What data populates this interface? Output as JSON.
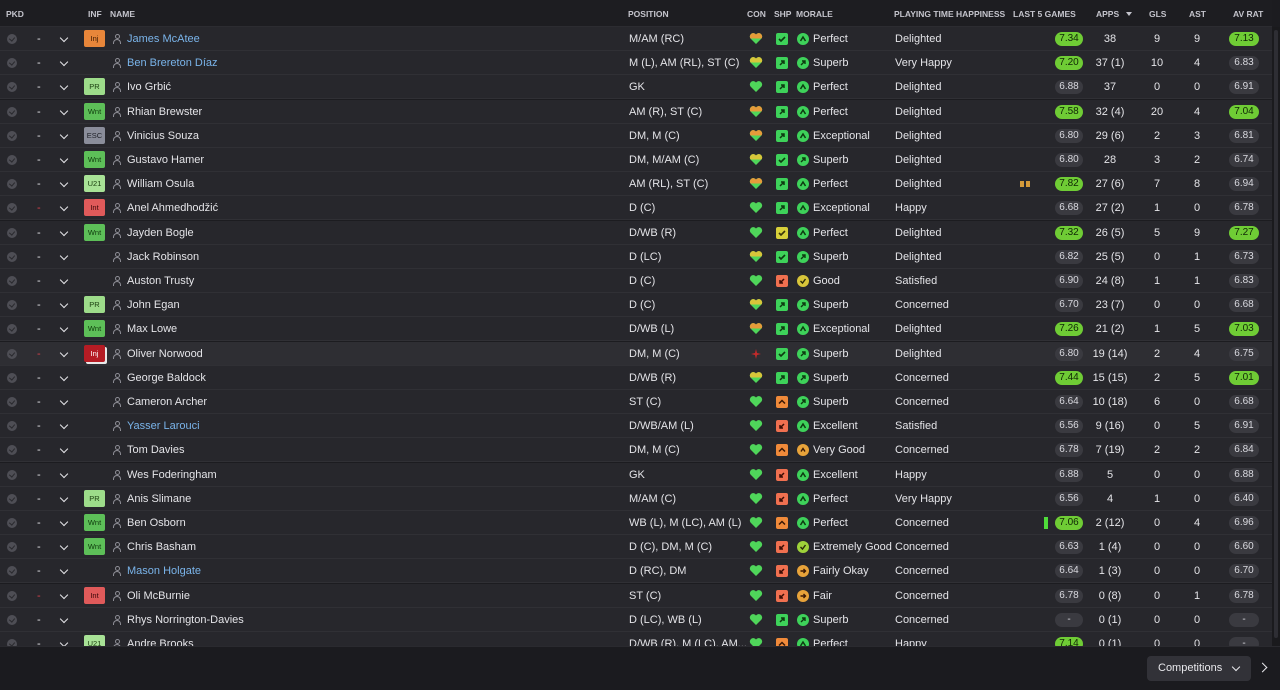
{
  "columns": {
    "pkd": "PKD",
    "inf": "INF",
    "name": "NAME",
    "position": "POSITION",
    "con": "CON",
    "shp": "SHP",
    "morale": "MORALE",
    "pth": "PLAYING TIME HAPPINESS",
    "last5": "LAST 5 GAMES",
    "apps": "APPS",
    "gls": "GLS",
    "ast": "AST",
    "avrat": "AV RAT"
  },
  "sort": {
    "column": "apps",
    "direction": "descending"
  },
  "colors": {
    "accent_green": "#6fcc35",
    "link_blue": "#7ab4ea",
    "injury_red": "#b51c24"
  },
  "players": [
    {
      "pkd": "-",
      "inf": "Inj",
      "name": "James McAtee",
      "link": true,
      "position": "M/AM (RC)",
      "con": "half",
      "shp": "check",
      "morale": "Perfect",
      "pth": "Delighted",
      "form": [
        "m",
        "m",
        "m",
        "m"
      ],
      "form_rating": "7.34",
      "form_green": true,
      "apps": "38",
      "gls": "9",
      "ast": "9",
      "avrat": "7.13",
      "avrat_green": true
    },
    {
      "pkd": "-",
      "inf": "",
      "name": "Ben Brereton Díaz",
      "link": true,
      "position": "M (L), AM (RL), ST (C)",
      "con": "half-y",
      "shp": "up-arrow",
      "morale": "Superb",
      "pth": "Very Happy",
      "form": [
        "h",
        "m",
        "m",
        "m"
      ],
      "form_rating": "7.20",
      "form_green": true,
      "apps": "37 (1)",
      "gls": "10",
      "ast": "4",
      "avrat": "6.83",
      "avrat_green": false
    },
    {
      "pkd": "-",
      "inf": "PR",
      "name": "Ivo Grbić",
      "link": false,
      "position": "GK",
      "con": "full",
      "shp": "up-arrow",
      "morale": "Perfect",
      "pth": "Delighted",
      "form": [
        "m",
        "m",
        "m",
        "m",
        "m"
      ],
      "form_rating": "6.88",
      "form_green": false,
      "apps": "37",
      "gls": "0",
      "ast": "0",
      "avrat": "6.91",
      "avrat_green": false
    },
    {
      "pkd": "-",
      "inf": "Wnt",
      "name": "Rhian Brewster",
      "link": false,
      "position": "AM (R), ST (C)",
      "con": "half",
      "shp": "up-arrow",
      "morale": "Perfect",
      "pth": "Delighted",
      "form": [
        "m",
        "m",
        "h",
        "m",
        "h"
      ],
      "form_rating": "7.58",
      "form_green": true,
      "apps": "32 (4)",
      "gls": "20",
      "ast": "4",
      "avrat": "7.04",
      "avrat_green": true
    },
    {
      "pkd": "-",
      "inf": "ESC",
      "name": "Vinicius Souza",
      "link": false,
      "position": "DM, M (C)",
      "con": "half",
      "shp": "up-arrow",
      "morale": "Exceptional",
      "pth": "Delighted",
      "form": [
        "m",
        "m",
        "m",
        "m",
        "m"
      ],
      "form_rating": "6.80",
      "form_green": false,
      "apps": "29 (6)",
      "gls": "2",
      "ast": "3",
      "avrat": "6.81",
      "avrat_green": false
    },
    {
      "pkd": "-",
      "inf": "Wnt",
      "name": "Gustavo Hamer",
      "link": false,
      "position": "DM, M/AM (C)",
      "con": "half-y",
      "shp": "check",
      "morale": "Superb",
      "pth": "Delighted",
      "form": [
        "m",
        "m",
        "m",
        "m",
        "m"
      ],
      "form_rating": "6.80",
      "form_green": false,
      "apps": "28",
      "gls": "3",
      "ast": "2",
      "avrat": "6.74",
      "avrat_green": false
    },
    {
      "pkd": "-",
      "inf": "U21",
      "name": "William Osula",
      "link": false,
      "position": "AM (RL), ST (C)",
      "con": "half",
      "shp": "up-arrow",
      "morale": "Perfect",
      "pth": "Delighted",
      "form": [
        "lo",
        "lo",
        "m",
        "h",
        "h"
      ],
      "form_rating": "7.82",
      "form_green": true,
      "apps": "27 (6)",
      "gls": "7",
      "ast": "8",
      "avrat": "6.94",
      "avrat_green": false
    },
    {
      "pkd": "-",
      "pkd_red": true,
      "inf": "Int",
      "name": "Anel Ahmedhodžić",
      "link": false,
      "position": "D (C)",
      "con": "full",
      "shp": "up-arrow",
      "morale": "Exceptional",
      "pth": "Happy",
      "form": [
        "m",
        "m",
        "m",
        "m",
        "m"
      ],
      "form_rating": "6.68",
      "form_green": false,
      "apps": "27 (2)",
      "gls": "1",
      "ast": "0",
      "avrat": "6.78",
      "avrat_green": false
    },
    {
      "pkd": "-",
      "inf": "Wnt",
      "name": "Jayden Bogle",
      "link": false,
      "position": "D/WB (R)",
      "con": "full",
      "shp": "check-y",
      "morale": "Perfect",
      "pth": "Delighted",
      "form": [
        "m",
        "m",
        "m",
        "m"
      ],
      "form_rating": "7.32",
      "form_green": true,
      "apps": "26 (5)",
      "gls": "5",
      "ast": "9",
      "avrat": "7.27",
      "avrat_green": true
    },
    {
      "pkd": "-",
      "inf": "",
      "name": "Jack Robinson",
      "link": false,
      "position": "D (LC)",
      "con": "half-y",
      "shp": "check",
      "morale": "Superb",
      "pth": "Delighted",
      "form": [
        "m",
        "m",
        "m",
        "m",
        "m"
      ],
      "form_rating": "6.82",
      "form_green": false,
      "apps": "25 (5)",
      "gls": "0",
      "ast": "1",
      "avrat": "6.73",
      "avrat_green": false
    },
    {
      "pkd": "-",
      "inf": "",
      "name": "Auston Trusty",
      "link": false,
      "position": "D (C)",
      "con": "full",
      "shp": "down-arrow",
      "morale": "Good",
      "pth": "Satisfied",
      "form": [
        "m",
        "m",
        "m",
        "m",
        "m"
      ],
      "form_rating": "6.90",
      "form_green": false,
      "apps": "24 (8)",
      "gls": "1",
      "ast": "1",
      "avrat": "6.83",
      "avrat_green": false
    },
    {
      "pkd": "-",
      "inf": "PR",
      "name": "John Egan",
      "link": false,
      "position": "D (C)",
      "con": "half-y",
      "shp": "up-arrow",
      "morale": "Superb",
      "pth": "Concerned",
      "form": [
        "m",
        "m",
        "m",
        "m",
        "m"
      ],
      "form_rating": "6.70",
      "form_green": false,
      "apps": "23 (7)",
      "gls": "0",
      "ast": "0",
      "avrat": "6.68",
      "avrat_green": false
    },
    {
      "pkd": "-",
      "inf": "Wnt",
      "name": "Max Lowe",
      "link": false,
      "position": "D/WB (L)",
      "con": "half",
      "shp": "up-arrow",
      "morale": "Exceptional",
      "pth": "Delighted",
      "form": [
        "m",
        "m",
        "m",
        "m"
      ],
      "form_rating": "7.26",
      "form_green": true,
      "apps": "21 (2)",
      "gls": "1",
      "ast": "5",
      "avrat": "7.03",
      "avrat_green": true
    },
    {
      "pkd": "-",
      "pkd_red": true,
      "inf": "InjRed",
      "inf_label": "Inj",
      "name": "Oliver Norwood",
      "link": false,
      "position": "DM, M (C)",
      "con": "injury",
      "shp": "check",
      "morale": "Superb",
      "pth": "Delighted",
      "form": [
        "m",
        "m",
        "m",
        "m",
        "m"
      ],
      "form_rating": "6.80",
      "form_green": false,
      "apps": "19 (14)",
      "gls": "2",
      "ast": "4",
      "avrat": "6.75",
      "avrat_green": false,
      "highlight": true
    },
    {
      "pkd": "-",
      "inf": "",
      "name": "George Baldock",
      "link": false,
      "position": "D/WB (R)",
      "con": "half-y",
      "shp": "up-arrow",
      "morale": "Superb",
      "pth": "Concerned",
      "form": [
        "h",
        "h",
        "h",
        "h"
      ],
      "form_rating": "7.44",
      "form_green": true,
      "apps": "15 (15)",
      "gls": "2",
      "ast": "5",
      "avrat": "7.01",
      "avrat_green": true
    },
    {
      "pkd": "-",
      "inf": "",
      "name": "Cameron Archer",
      "link": false,
      "position": "ST (C)",
      "con": "full",
      "shp": "up-o",
      "morale": "Superb",
      "pth": "Concerned",
      "form": [
        "m",
        "m",
        "m",
        "m",
        "m"
      ],
      "form_rating": "6.64",
      "form_green": false,
      "apps": "10 (18)",
      "gls": "6",
      "ast": "0",
      "avrat": "6.68",
      "avrat_green": false
    },
    {
      "pkd": "-",
      "inf": "",
      "name": "Yasser Larouci",
      "link": true,
      "position": "D/WB/AM (L)",
      "con": "full",
      "shp": "down-arrow",
      "morale": "Excellent",
      "pth": "Satisfied",
      "form": [
        "m",
        "m",
        "m",
        "m",
        "m"
      ],
      "form_rating": "6.56",
      "form_green": false,
      "apps": "9 (16)",
      "gls": "0",
      "ast": "5",
      "avrat": "6.91",
      "avrat_green": false
    },
    {
      "pkd": "-",
      "inf": "",
      "name": "Tom Davies",
      "link": false,
      "position": "DM, M (C)",
      "con": "full",
      "shp": "up-o",
      "morale": "Very Good",
      "pth": "Concerned",
      "form": [
        "m",
        "m",
        "m",
        "m",
        "m"
      ],
      "form_rating": "6.78",
      "form_green": false,
      "apps": "7 (19)",
      "gls": "2",
      "ast": "2",
      "avrat": "6.84",
      "avrat_green": false
    },
    {
      "pkd": "-",
      "inf": "",
      "name": "Wes Foderingham",
      "link": false,
      "position": "GK",
      "con": "full",
      "shp": "down-arrow",
      "morale": "Excellent",
      "pth": "Happy",
      "form": [
        "m",
        "m",
        "m",
        "m",
        "m"
      ],
      "form_rating": "6.88",
      "form_green": false,
      "apps": "5",
      "gls": "0",
      "ast": "0",
      "avrat": "6.88",
      "avrat_green": false
    },
    {
      "pkd": "-",
      "inf": "PR",
      "name": "Anis Slimane",
      "link": false,
      "position": "M/AM (C)",
      "con": "full",
      "shp": "down-arrow",
      "morale": "Perfect",
      "pth": "Very Happy",
      "form": [
        "m",
        "m",
        "m",
        "m",
        "m"
      ],
      "form_rating": "6.56",
      "form_green": false,
      "apps": "4",
      "gls": "1",
      "ast": "0",
      "avrat": "6.40",
      "avrat_green": false
    },
    {
      "pkd": "-",
      "inf": "Wnt",
      "name": "Ben Osborn",
      "link": false,
      "position": "WB (L), M (LC), AM (L)",
      "con": "full",
      "shp": "up-o",
      "morale": "Perfect",
      "pth": "Concerned",
      "form": [
        "vh"
      ],
      "form_rating": "7.06",
      "form_green": true,
      "apps": "2 (12)",
      "gls": "0",
      "ast": "4",
      "avrat": "6.96",
      "avrat_green": false
    },
    {
      "pkd": "-",
      "inf": "Wnt",
      "name": "Chris Basham",
      "link": false,
      "position": "D (C), DM, M (C)",
      "con": "full",
      "shp": "down-arrow",
      "morale": "Extremely Good",
      "pth": "Concerned",
      "form": [
        "m",
        "m",
        "m"
      ],
      "form_rating": "6.63",
      "form_green": false,
      "apps": "1 (4)",
      "gls": "0",
      "ast": "0",
      "avrat": "6.60",
      "avrat_green": false
    },
    {
      "pkd": "-",
      "inf": "",
      "name": "Mason Holgate",
      "link": true,
      "position": "D (RC), DM",
      "con": "full",
      "shp": "down-arrow",
      "morale": "Fairly Okay",
      "pth": "Concerned",
      "form": [
        "m",
        "m",
        "m",
        "m",
        "m"
      ],
      "form_rating": "6.64",
      "form_green": false,
      "apps": "1 (3)",
      "gls": "0",
      "ast": "0",
      "avrat": "6.70",
      "avrat_green": false
    },
    {
      "pkd": "-",
      "pkd_red": true,
      "inf": "Int",
      "name": "Oli McBurnie",
      "link": false,
      "position": "ST (C)",
      "con": "full",
      "shp": "down-arrow",
      "morale": "Fair",
      "pth": "Concerned",
      "form": [
        "m",
        "m",
        "m",
        "m",
        "m"
      ],
      "form_rating": "6.78",
      "form_green": false,
      "apps": "0 (8)",
      "gls": "0",
      "ast": "1",
      "avrat": "6.78",
      "avrat_green": false
    },
    {
      "pkd": "-",
      "inf": "",
      "name": "Rhys Norrington-Davies",
      "link": false,
      "position": "D (LC), WB (L)",
      "con": "full",
      "shp": "up-arrow",
      "morale": "Superb",
      "pth": "Concerned",
      "form": [],
      "form_rating": "-",
      "form_green": false,
      "apps": "0 (1)",
      "gls": "0",
      "ast": "0",
      "avrat": "-",
      "avrat_green": false
    },
    {
      "pkd": "-",
      "inf": "U21",
      "name": "Andre Brooks",
      "link": false,
      "position": "D/WB (R), M (LC), AM...",
      "con": "full",
      "shp": "up-o",
      "morale": "Perfect",
      "pth": "Happy",
      "form": [
        "m"
      ],
      "form_rating": "7.14",
      "form_green": true,
      "apps": "0 (1)",
      "gls": "0",
      "ast": "0",
      "avrat": "-",
      "avrat_green": false
    }
  ],
  "footer": {
    "competitions_label": "Competitions"
  }
}
